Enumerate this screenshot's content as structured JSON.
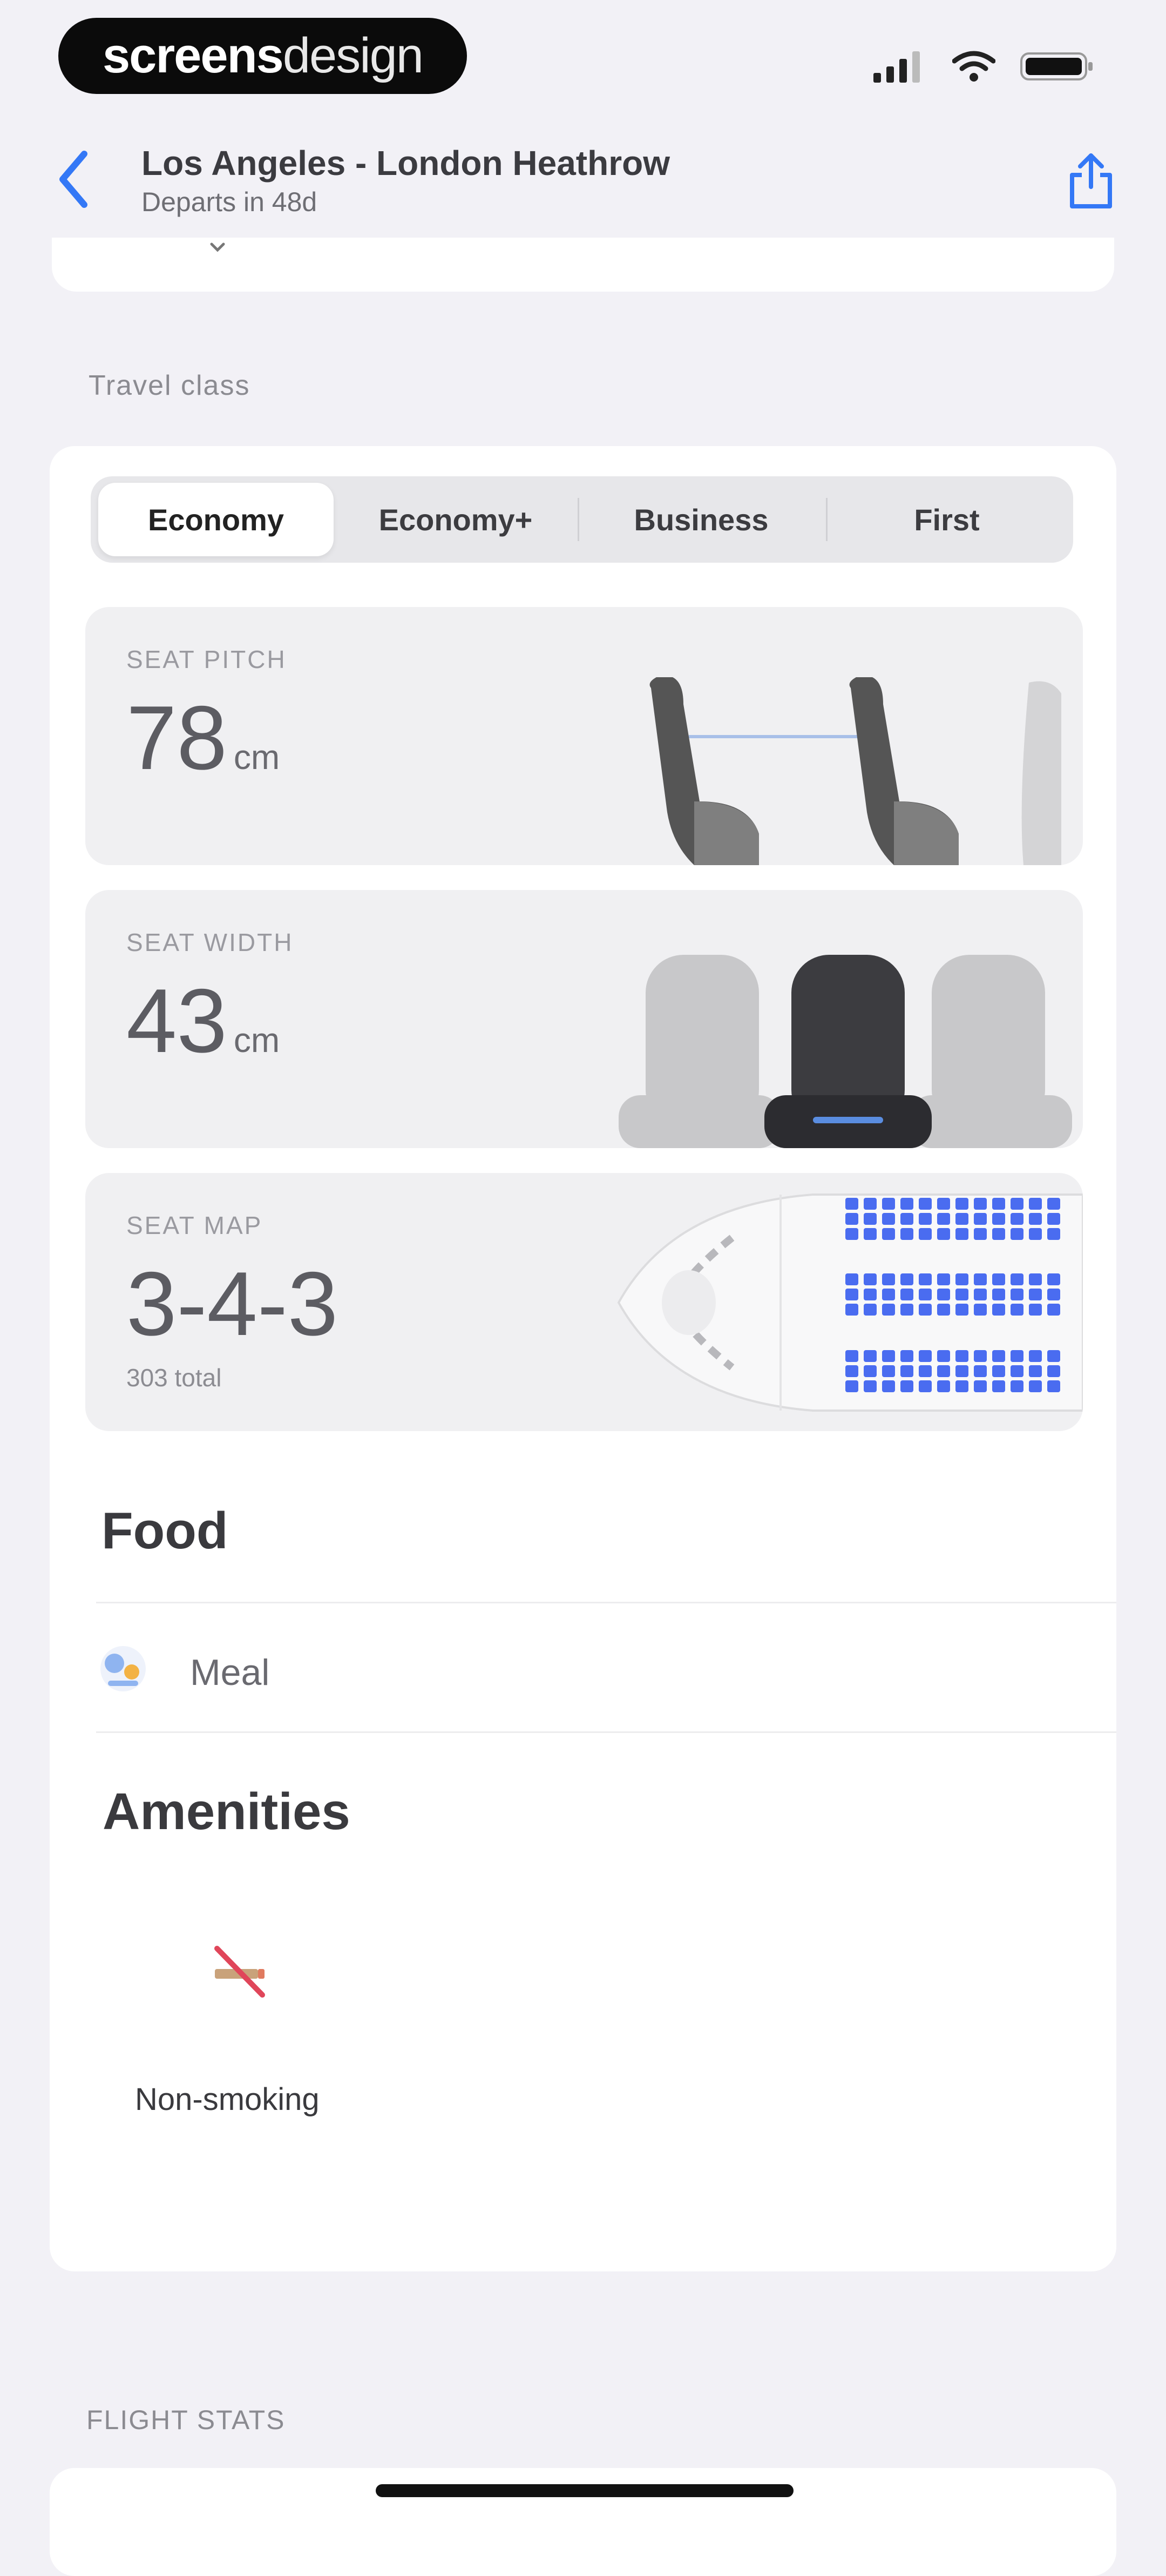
{
  "status_bar": {
    "brand_bold": "screens",
    "brand_light": "design"
  },
  "nav": {
    "title": "Los Angeles - London Heathrow",
    "subtitle": "Departs in 48d"
  },
  "travel_class": {
    "section_label": "Travel class",
    "tabs": [
      "Economy",
      "Economy+",
      "Business",
      "First"
    ],
    "selected": "Economy"
  },
  "seat_pitch": {
    "label": "SEAT PITCH",
    "value": "78",
    "unit": "cm"
  },
  "seat_width": {
    "label": "SEAT WIDTH",
    "value": "43",
    "unit": "cm"
  },
  "seat_map": {
    "label": "SEAT MAP",
    "value": "3-4-3",
    "total": "303 total"
  },
  "food": {
    "heading": "Food",
    "items": [
      {
        "icon": "meal-icon",
        "label": "Meal"
      }
    ]
  },
  "amenities": {
    "heading": "Amenities",
    "items": [
      {
        "icon": "non-smoking-icon",
        "label": "Non-smoking"
      }
    ]
  },
  "flight_stats": {
    "section_label": "FLIGHT STATS"
  },
  "colors": {
    "accent": "#3478f6",
    "seat_blue": "#4a6cf0",
    "background": "#f2f1f6"
  }
}
